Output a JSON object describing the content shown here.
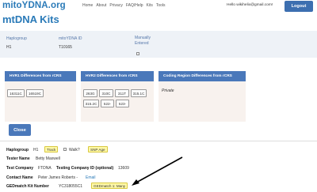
{
  "header": {
    "brand": "mitoYDNA.org",
    "nav": [
      "Home",
      "About",
      "Privacy",
      "FAQ/Help",
      "Kits",
      "Tools"
    ],
    "user_text": "Hello wikihelix@gmail.com!",
    "logout": "Logout"
  },
  "page_title": "mtDNA Kits",
  "summary": {
    "haplogroup_label": "Haplogroup",
    "haplogroup_value": "H1",
    "kit_label": "mitoYDNA ID",
    "kit_value": "T10165",
    "manual_label_1": "Manually",
    "manual_label_2": "Entered"
  },
  "panels": {
    "hvr1_title": "HVR1 Differences from rCRS",
    "hvr1": [
      "16311C",
      "16519C"
    ],
    "hvr2_title": "HVR2 Differences from rCRS",
    "hvr2_row1": [
      "263G",
      "310C",
      "311T",
      "315.1C"
    ],
    "hvr2_row2": [
      "315.2C",
      "522-",
      "523-"
    ],
    "coding_title": "Coding Region Differences from rCRS",
    "coding_value": "Private"
  },
  "close_label": "Close",
  "details": {
    "haplogroup_label": "Haplogroup",
    "haplogroup_value": "H1",
    "track_tag": "Track",
    "walk_label": "Walk?",
    "snp_tag": "SNP Age",
    "tester_label": "Tester Name",
    "tester_value": "Betty Maxwell",
    "company_label": "Test Company",
    "company_value": "FTDNA",
    "company_id_label": "Testing Company ID (optional)",
    "company_id_value": "13609",
    "contact_label": "Contact Name",
    "contact_value": "Peter James Roberts -",
    "contact_email": "Email",
    "ged_label": "GEDmatch Kit Number",
    "ged_value": "YC318055C1",
    "ged_tag": "GEDmatch 1: Many"
  }
}
